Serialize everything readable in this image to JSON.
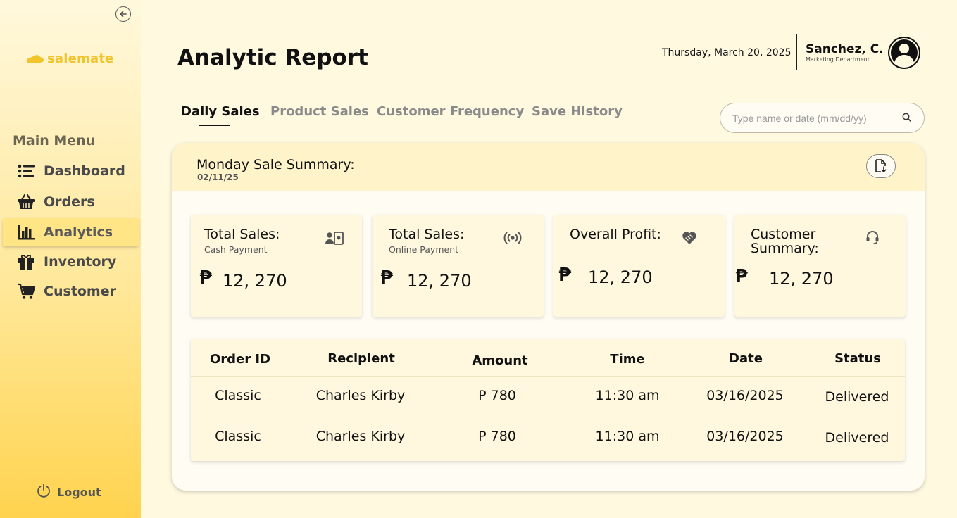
{
  "app": {
    "logo_text": "salemate",
    "brand_color": "#F2C42C"
  },
  "sidebar": {
    "menu_title": "Main Menu",
    "items": [
      {
        "label": "Dashboard",
        "icon": "list-icon",
        "active": false
      },
      {
        "label": "Orders",
        "icon": "basket-icon",
        "active": false
      },
      {
        "label": "Analytics",
        "icon": "bar-chart-icon",
        "active": true
      },
      {
        "label": "Inventory",
        "icon": "gift-box-icon",
        "active": false
      },
      {
        "label": "Customer",
        "icon": "cart-icon",
        "active": false
      }
    ],
    "logout_label": "Logout"
  },
  "header": {
    "title": "Analytic Report",
    "date": "Thursday, March 20, 2025",
    "user_name": "Sanchez, C.",
    "user_department": "Marketing Department"
  },
  "tabs": [
    {
      "label": "Daily Sales",
      "active": true
    },
    {
      "label": "Product Sales",
      "active": false
    },
    {
      "label": "Customer Frequency",
      "active": false
    },
    {
      "label": "Save History",
      "active": false
    }
  ],
  "search": {
    "placeholder": "Type name or date (mm/dd/yy)",
    "value": ""
  },
  "summary": {
    "title": "Monday Sale Summary:",
    "date": "02/11/25"
  },
  "cards": [
    {
      "title": "Total Sales:",
      "subtitle": "Cash Payment",
      "currency": "₱",
      "value": "12, 270",
      "icon": "cash-register-icon"
    },
    {
      "title": "Total Sales:",
      "subtitle": "Online Payment",
      "currency": "₱",
      "value": "12, 270",
      "icon": "broadcast-icon"
    },
    {
      "title": "Overall Profit:",
      "subtitle": "",
      "currency": "₱",
      "value": "12, 270",
      "icon": "heart-handshake-icon"
    },
    {
      "title": "Customer Summary:",
      "title_line1": "Customer",
      "title_line2": "Summary:",
      "subtitle": "",
      "currency": "₱",
      "value": "12, 270",
      "icon": "headset-icon"
    }
  ],
  "table": {
    "columns": [
      "Order ID",
      "Recipient",
      "Amount",
      "Time",
      "Date",
      "Status"
    ],
    "rows": [
      [
        "Classic",
        "Charles Kirby",
        "P 780",
        "11:30 am",
        "03/16/2025",
        "Delivered"
      ],
      [
        "Classic",
        "Charles Kirby",
        "P 780",
        "11:30 am",
        "03/16/2025",
        "Delivered"
      ]
    ]
  }
}
